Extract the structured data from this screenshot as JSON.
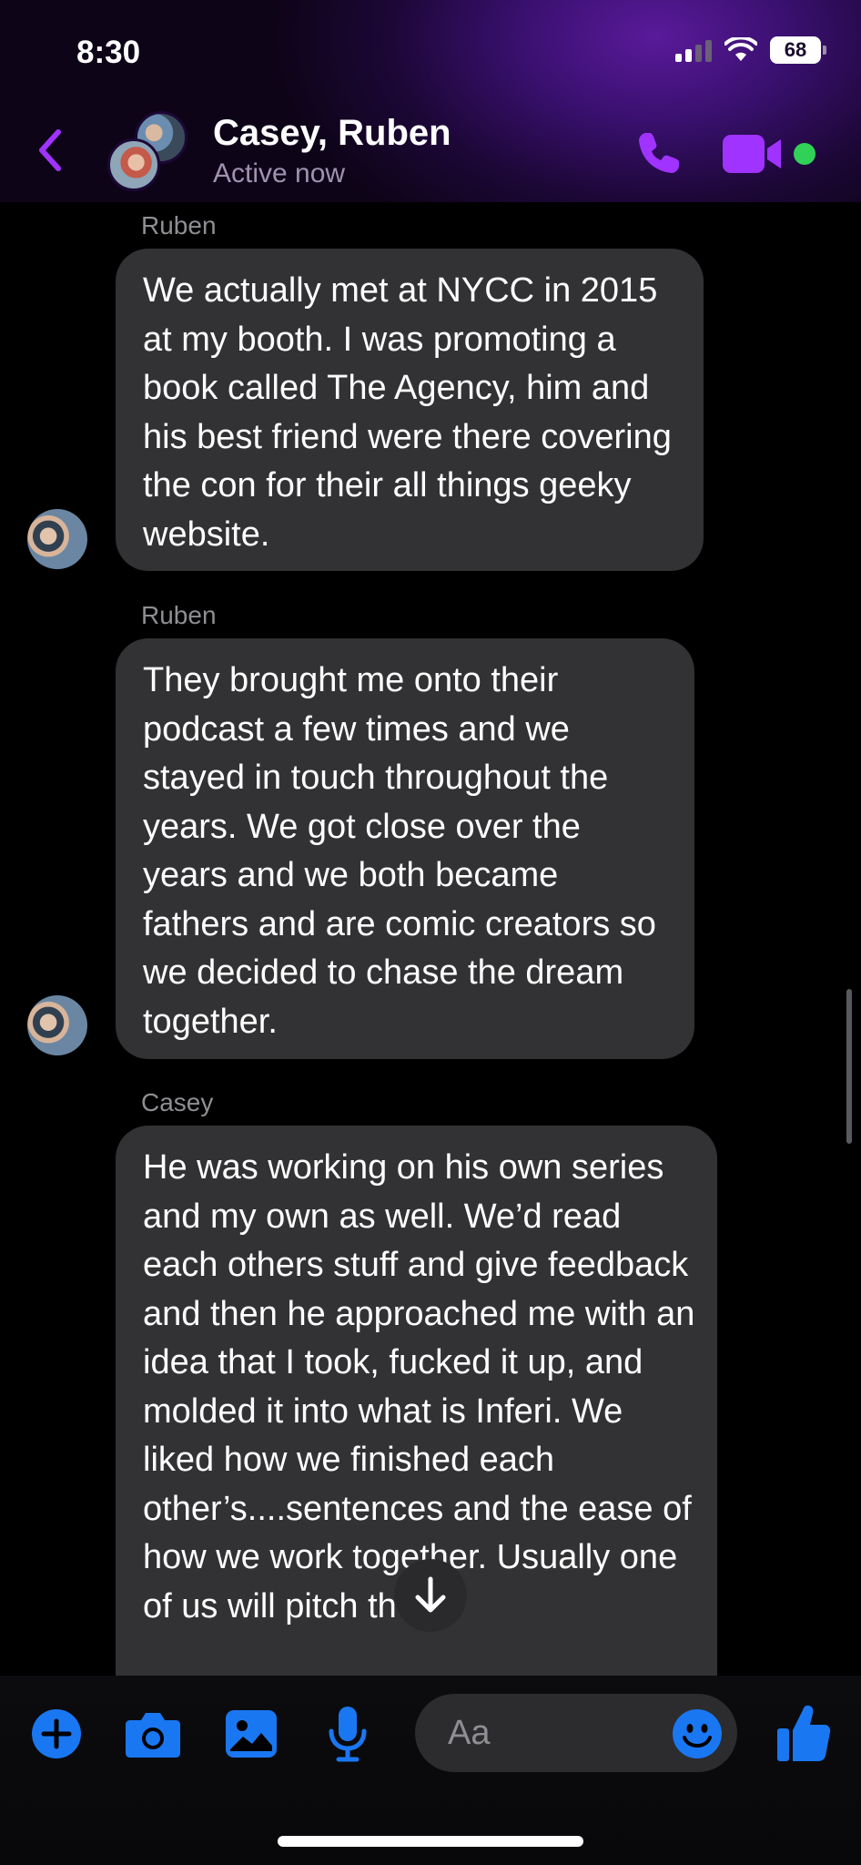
{
  "status_bar": {
    "time": "8:30",
    "battery": "68"
  },
  "header": {
    "contact_name": "Casey, Ruben",
    "presence": "Active now",
    "accent_color": "#a033ff",
    "online_color": "#31d158"
  },
  "messages": [
    {
      "sender": "Ruben",
      "text": "We actually met at NYCC in 2015 at my booth. I was promoting a book called The Agency, him and his best friend were there covering the con for their all things geeky website."
    },
    {
      "sender": "Ruben",
      "text": "They brought me onto their podcast a few times and we stayed in touch throughout the years. We got close over the years and we both became fathers and are comic creators so we decided to chase the dream together."
    },
    {
      "sender": "Casey",
      "text": "He was working on his own series and my own as well. We’d read each others stuff and give feedback and then he approached me with an idea that I took, fucked it up, and molded it into what is Inferi. We liked how we finished each other’s....sentences and the ease of how we work together. Usually one of us will pitch the"
    }
  ],
  "composer": {
    "placeholder": "Aa",
    "icon_color": "#1a77f2",
    "icons": [
      "plus-icon",
      "camera-icon",
      "gallery-icon",
      "microphone-icon",
      "emoji-icon",
      "thumbs-up-icon"
    ]
  }
}
